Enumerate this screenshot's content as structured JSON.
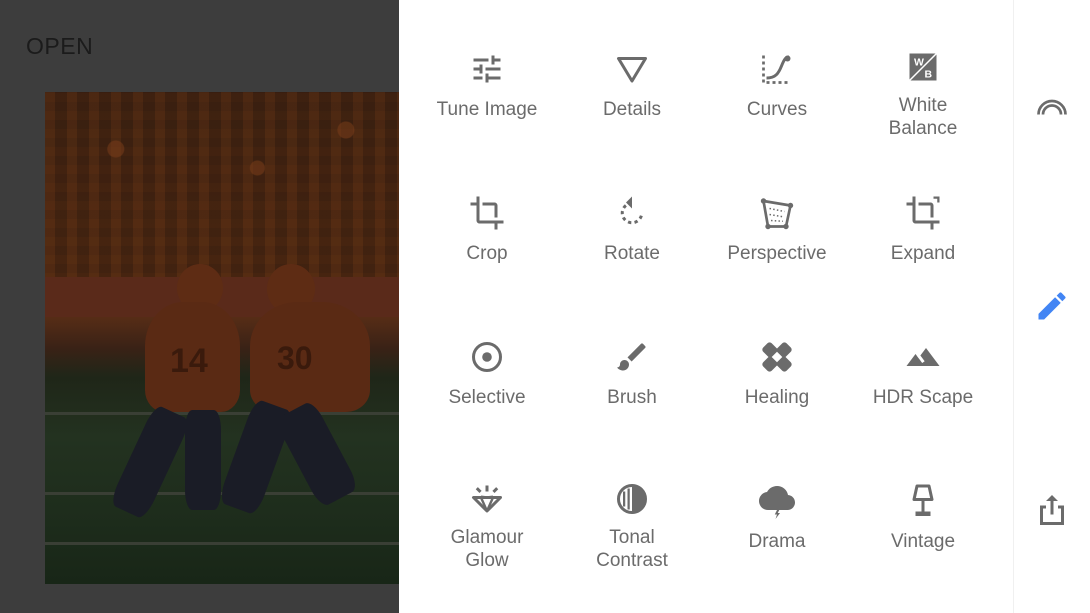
{
  "header": {
    "open_label": "OPEN"
  },
  "photo": {
    "numbers": [
      "14",
      "30"
    ]
  },
  "tools": [
    {
      "label": "Tune Image",
      "icon": "tune-image-icon"
    },
    {
      "label": "Details",
      "icon": "details-icon"
    },
    {
      "label": "Curves",
      "icon": "curves-icon"
    },
    {
      "label": "White\nBalance",
      "icon": "white-balance-icon"
    },
    {
      "label": "Crop",
      "icon": "crop-icon"
    },
    {
      "label": "Rotate",
      "icon": "rotate-icon"
    },
    {
      "label": "Perspective",
      "icon": "perspective-icon"
    },
    {
      "label": "Expand",
      "icon": "expand-icon"
    },
    {
      "label": "Selective",
      "icon": "selective-icon"
    },
    {
      "label": "Brush",
      "icon": "brush-icon"
    },
    {
      "label": "Healing",
      "icon": "healing-icon"
    },
    {
      "label": "HDR Scape",
      "icon": "hdr-scape-icon"
    },
    {
      "label": "Glamour\nGlow",
      "icon": "glamour-glow-icon"
    },
    {
      "label": "Tonal\nContrast",
      "icon": "tonal-contrast-icon"
    },
    {
      "label": "Drama",
      "icon": "drama-icon"
    },
    {
      "label": "Vintage",
      "icon": "vintage-icon"
    }
  ],
  "rail": {
    "items": [
      {
        "icon": "looks-icon"
      },
      {
        "icon": "tools-pencil-icon",
        "color": "#4285f4"
      },
      {
        "icon": "export-icon"
      }
    ]
  },
  "colors": {
    "icon": "#6b6b6b",
    "label": "#6b6b6b",
    "accent": "#4285f4",
    "panel_bg": "#ffffff",
    "dim_bg": "#3d3d3d"
  }
}
